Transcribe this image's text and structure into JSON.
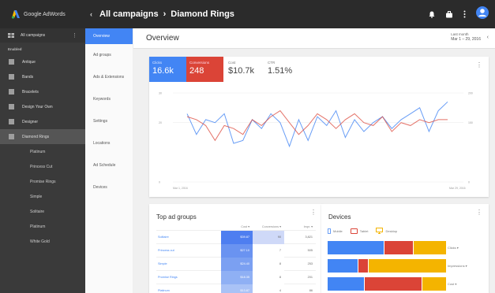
{
  "brand": {
    "name": "Google AdWords"
  },
  "topbar": {
    "back": "‹",
    "crumb_root": "All campaigns",
    "crumb_sep": "›",
    "crumb_current": "Diamond Rings"
  },
  "sidebar": {
    "head": "All campaigns",
    "section": "Enabled",
    "items": [
      {
        "label": "Antique"
      },
      {
        "label": "Bands"
      },
      {
        "label": "Bracelets"
      },
      {
        "label": "Design Your Own"
      },
      {
        "label": "Designer"
      },
      {
        "label": "Diamond Rings"
      }
    ],
    "subitems": [
      {
        "label": "Platinum"
      },
      {
        "label": "Princess Cut"
      },
      {
        "label": "Promise Rings"
      },
      {
        "label": "Simple"
      },
      {
        "label": "Solitaire"
      },
      {
        "label": "Platinum"
      },
      {
        "label": "White Gold"
      }
    ]
  },
  "nav": {
    "items": [
      {
        "label": "Overview"
      },
      {
        "label": "Ad groups"
      },
      {
        "label": "Ads & Extensions"
      },
      {
        "label": "Keywords"
      },
      {
        "label": "Settings"
      },
      {
        "label": "Locations"
      },
      {
        "label": "Ad Schedule"
      },
      {
        "label": "Devices"
      }
    ]
  },
  "overview": {
    "title": "Overview",
    "date_label": "Last month",
    "date_range": "Mar 1 – 29, 2016"
  },
  "kpis": [
    {
      "label": "Clicks",
      "value": "16.6k"
    },
    {
      "label": "Conversions",
      "value": "248"
    },
    {
      "label": "Cost",
      "value": "$10.7k"
    },
    {
      "label": "CTR",
      "value": "1.51%"
    }
  ],
  "chart_data": {
    "type": "line",
    "x_start_label": "Mar 1, 2016",
    "x_end_label": "Mar 29, 2016",
    "yleft_ticks": [
      "30",
      "20",
      "0"
    ],
    "yright_ticks": [
      "200",
      "150",
      "0"
    ],
    "ylim": [
      0,
      30
    ],
    "series": [
      {
        "name": "Clicks",
        "color": "#4285f4",
        "values": [
          23,
          16,
          21,
          20,
          23,
          13,
          14,
          21,
          18,
          23,
          20,
          12,
          21,
          14,
          22,
          19,
          24,
          15,
          21,
          17,
          20,
          22,
          18,
          21,
          23,
          25,
          17,
          24,
          27
        ]
      },
      {
        "name": "Conversions",
        "color": "#db4437",
        "values": [
          22,
          21,
          19,
          14,
          19,
          18,
          16,
          21,
          19,
          22,
          24,
          20,
          16,
          19,
          23,
          21,
          18,
          21,
          23,
          20,
          19,
          22,
          17,
          20,
          19,
          21,
          20,
          21,
          21
        ]
      }
    ]
  },
  "adgroups": {
    "title": "Top ad groups",
    "headers": {
      "cost": "Cost ▾",
      "conv": "Conversions ▾",
      "impr": "Impr. ▾"
    },
    "rows": [
      {
        "name": "Solitaire",
        "cost": "$39.87",
        "conv": "90",
        "impr": "3,821",
        "shade": "#4e7ef0",
        "conv_shade": "#cfd9f8"
      },
      {
        "name": "Princess cut",
        "cost": "$27.10",
        "conv": "7",
        "impr": "505",
        "shade": "#6a93f1",
        "conv_shade": "#ffffff"
      },
      {
        "name": "Simple",
        "cost": "$24.40",
        "conv": "8",
        "impr": "253",
        "shade": "#7ba0f2",
        "conv_shade": "#ffffff"
      },
      {
        "name": "Promise Rings",
        "cost": "$18.35",
        "conv": "8",
        "impr": "201",
        "shade": "#8fb0f4",
        "conv_shade": "#ffffff"
      },
      {
        "name": "Platinum",
        "cost": "$13.87",
        "conv": "4",
        "impr": "86",
        "shade": "#a9c2f6",
        "conv_shade": "#ffffff"
      }
    ]
  },
  "devices": {
    "title": "Devices",
    "legend": [
      {
        "label": "Mobile",
        "color": "#4285f4",
        "icon": "phone-icon"
      },
      {
        "label": "Tablet",
        "color": "#db4437",
        "icon": "tablet-icon"
      },
      {
        "label": "Desktop",
        "color": "#f4b400",
        "icon": "desktop-icon"
      }
    ],
    "rows": [
      {
        "label": "Clicks ▾",
        "segments": [
          0.48,
          0.24,
          0.28
        ]
      },
      {
        "label": "Impressions ▾",
        "segments": [
          0.26,
          0.08,
          0.66
        ]
      },
      {
        "label": "Cost ▾",
        "segments": [
          0.31,
          0.49,
          0.2
        ]
      }
    ]
  },
  "colors": {
    "blue": "#4285f4",
    "red": "#db4437",
    "yellow": "#f4b400",
    "topbar": "#2b2b2b",
    "sidebar": "#3a3a3a"
  }
}
